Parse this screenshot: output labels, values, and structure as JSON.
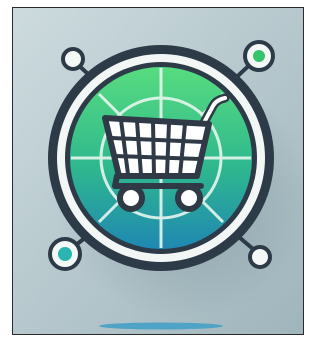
{
  "artwork": {
    "subject": "shopping-cart",
    "colors": {
      "background_light": "#c9d7da",
      "background_dark": "#93aab1",
      "ring_outer": "#2d3a48",
      "ring_inner": "#f4f8f6",
      "disc_top": "#49d67a",
      "disc_bottom": "#1f8fb0",
      "grid_line": "#e9f7f0",
      "cart_stroke": "#2f3a46",
      "cart_fill": "#ffffff",
      "node_green": "#37c26c",
      "node_teal": "#2bb5b1",
      "base_line": "#4fa3c6"
    },
    "icons": {
      "main": "shopping-cart-icon",
      "nodes": [
        "node-top-left",
        "node-top-right",
        "node-bottom-left",
        "node-bottom-right"
      ]
    }
  }
}
